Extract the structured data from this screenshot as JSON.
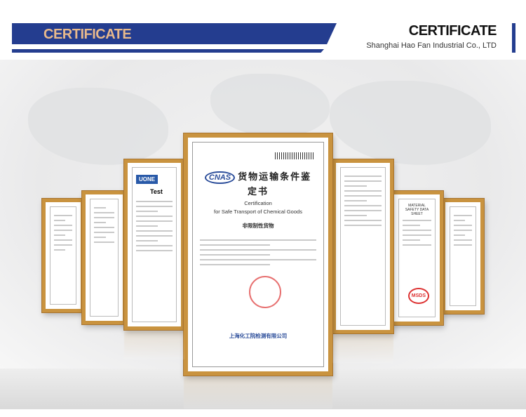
{
  "header": {
    "banner_title": "CERTIFICATE",
    "title": "CERTIFICATE",
    "company": "Shanghai Hao Fan Industrial Co., LTD",
    "accent_color": "#243d8f",
    "banner_text_color": "#e8b98c"
  },
  "certificates": {
    "main": {
      "logo": "CNAS",
      "title_cn": "货物运输条件鉴定书",
      "title_en_1": "Certification",
      "title_en_2": "for Safe Transport of Chemical Goods",
      "subtitle_cn": "非限制性货物",
      "issuer_cn": "上海化工院检测有限公司"
    },
    "test_report": {
      "logo": "UONE",
      "heading": "Test"
    },
    "msds": {
      "heading": "MATERIAL SAFETY DATA SHEET",
      "stamp": "MSDS"
    },
    "frame_color": "#c9933f"
  }
}
